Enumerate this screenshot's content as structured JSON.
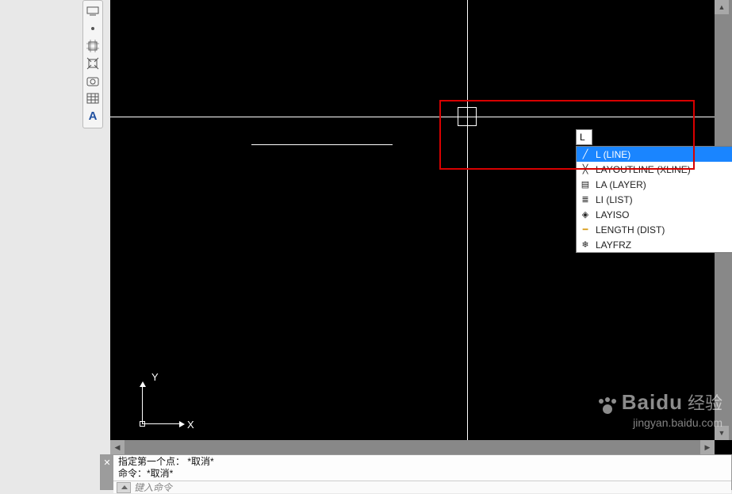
{
  "toolbar": {
    "items": [
      {
        "name": "tool-icon-1"
      },
      {
        "name": "tool-icon-2"
      },
      {
        "name": "tool-icon-3"
      },
      {
        "name": "tool-icon-4"
      },
      {
        "name": "tool-icon-5"
      },
      {
        "name": "tool-icon-6"
      },
      {
        "name": "text-tool",
        "glyph": "A"
      }
    ]
  },
  "canvas": {
    "ucs": {
      "y_label": "Y",
      "x_label": "X"
    }
  },
  "dynamic_input": {
    "value": "L"
  },
  "autocomplete": {
    "items": [
      {
        "label": "L (LINE)",
        "icon": "line-icon",
        "selected": true
      },
      {
        "label": "LAYOUTLINE (XLINE)",
        "icon": "xline-icon",
        "selected": false
      },
      {
        "label": "LA (LAYER)",
        "icon": "layer-icon",
        "selected": false
      },
      {
        "label": "LI (LIST)",
        "icon": "list-icon",
        "selected": false
      },
      {
        "label": "LAYISO",
        "icon": "layiso-icon",
        "selected": false
      },
      {
        "label": "LENGTH (DIST)",
        "icon": "dist-icon",
        "selected": false
      },
      {
        "label": "LAYFRZ",
        "icon": "layfrz-icon",
        "selected": false
      }
    ]
  },
  "command_line": {
    "history1": "指定第一个点： *取消*",
    "history2": "命令：*取消*",
    "prompt": "键入命令"
  },
  "watermark": {
    "brand": "Baidu",
    "cn": "经验",
    "url": "jingyan.baidu.com"
  }
}
